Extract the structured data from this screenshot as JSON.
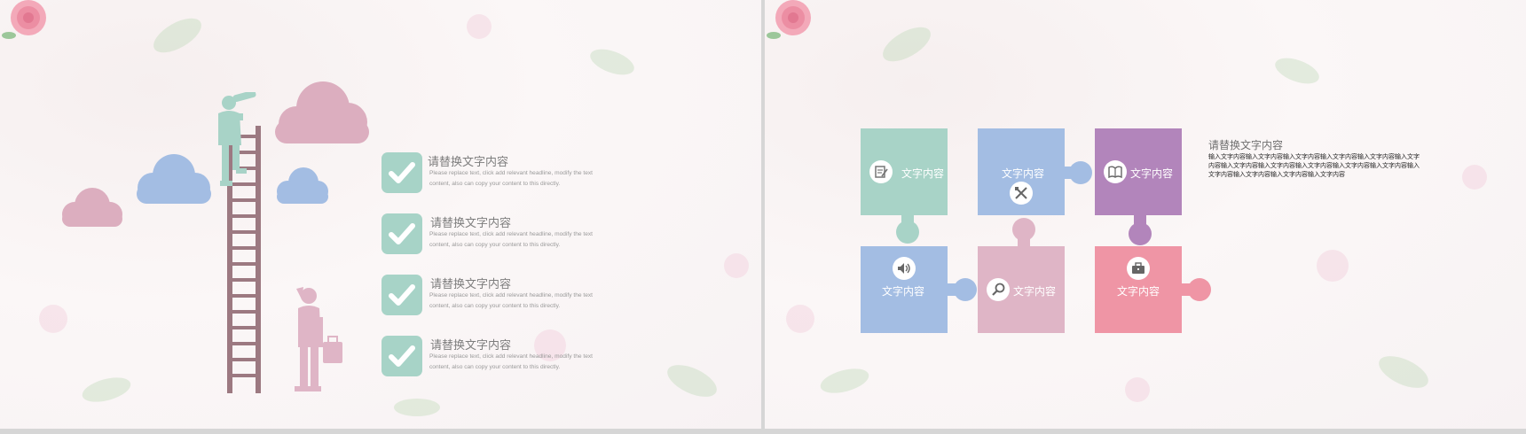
{
  "left_slide": {
    "items": [
      {
        "title": "请替换文字内容",
        "desc": "Please replace text, click add relevant headline, modify the text content, also can copy your content to this directly."
      },
      {
        "title": "请替换文字内容",
        "desc": "Please replace text, click add relevant headline, modify the text content, also can copy your content to this directly."
      },
      {
        "title": "请替换文字内容",
        "desc": "Please replace text, click add relevant headline, modify the text content, also can copy your content to this directly."
      },
      {
        "title": "请替换文字内容",
        "desc": "Please replace text, click add relevant headline, modify the text content, also can copy your content to this directly."
      }
    ],
    "icons": [
      "rose-icon",
      "cloud-icon",
      "ladder-icon",
      "telescope-person-icon",
      "person-briefcase-icon",
      "checkmark-icon"
    ]
  },
  "right_slide": {
    "pieces": [
      {
        "label": "文字内容",
        "color": "#a8d3c7",
        "icon": "edit-note-icon"
      },
      {
        "label": "文字内容",
        "color": "#a3bde3",
        "icon": "tools-icon"
      },
      {
        "label": "文字内容",
        "color": "#b285bb",
        "icon": "book-icon"
      },
      {
        "label": "文字内容",
        "color": "#a3bde3",
        "icon": "speaker-icon"
      },
      {
        "label": "文字内容",
        "color": "#dfb5c6",
        "icon": "search-icon"
      },
      {
        "label": "文字内容",
        "color": "#ef95a5",
        "icon": "briefcase-icon"
      }
    ],
    "text_title": "请替换文字内容",
    "text_body": "输入文字内容输入文字内容输入文字内容输入文字内容输入文字内容输入文字内容输入文字内容输入文字内容输入文字内容输入文字内容输入文字内容输入文字内容输入文字内容输入文字内容输入文字内容"
  },
  "colors": {
    "mint": "#a8d3c7",
    "blue": "#a3bde3",
    "pink": "#dfb5c6",
    "purple": "#b285bb",
    "rose": "#ef95a5",
    "ladder": "#9c7981"
  }
}
